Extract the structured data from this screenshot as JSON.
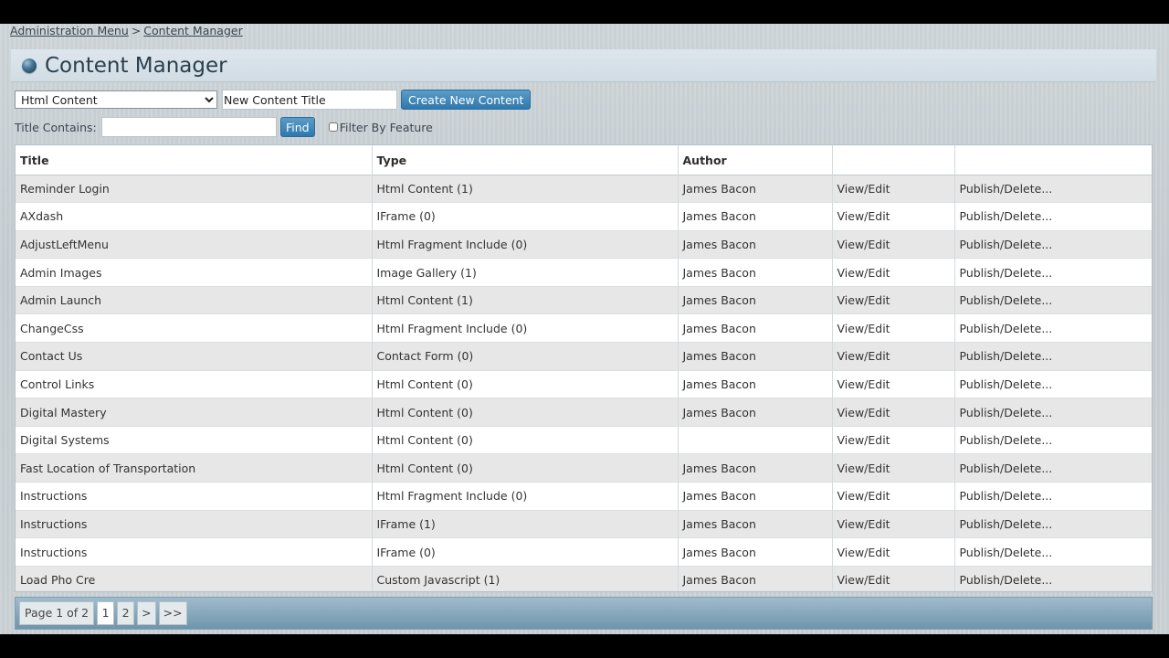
{
  "breadcrumb": {
    "items": [
      "Administration Menu",
      "Content Manager"
    ],
    "separator": ">"
  },
  "page": {
    "title": "Content Manager"
  },
  "create_bar": {
    "type_select_value": "Html Content",
    "new_title_value": "New Content Title",
    "create_button_label": "Create New Content"
  },
  "filter_bar": {
    "title_contains_label": "Title Contains:",
    "title_contains_value": "",
    "find_button_label": "Find",
    "filter_by_feature_label": "Filter By Feature",
    "filter_by_feature_checked": false
  },
  "table": {
    "columns": [
      "Title",
      "Type",
      "Author",
      "",
      ""
    ],
    "rows": [
      {
        "title": "Reminder Login",
        "type": "Html Content (1)",
        "author": "James Bacon",
        "view": "View/Edit",
        "publish": "Publish/Delete..."
      },
      {
        "title": "AXdash",
        "type": "IFrame (0)",
        "author": "James Bacon",
        "view": "View/Edit",
        "publish": "Publish/Delete..."
      },
      {
        "title": "AdjustLeftMenu",
        "type": "Html Fragment Include (0)",
        "author": "James Bacon",
        "view": "View/Edit",
        "publish": "Publish/Delete..."
      },
      {
        "title": "Admin Images",
        "type": "Image Gallery (1)",
        "author": "James Bacon",
        "view": "View/Edit",
        "publish": "Publish/Delete..."
      },
      {
        "title": "Admin Launch",
        "type": "Html Content (1)",
        "author": "James Bacon",
        "view": "View/Edit",
        "publish": "Publish/Delete..."
      },
      {
        "title": "ChangeCss",
        "type": "Html Fragment Include (0)",
        "author": "James Bacon",
        "view": "View/Edit",
        "publish": "Publish/Delete..."
      },
      {
        "title": "Contact Us",
        "type": "Contact Form (0)",
        "author": "James Bacon",
        "view": "View/Edit",
        "publish": "Publish/Delete..."
      },
      {
        "title": "Control Links",
        "type": "Html Content (0)",
        "author": "James Bacon",
        "view": "View/Edit",
        "publish": "Publish/Delete..."
      },
      {
        "title": "Digital Mastery",
        "type": "Html Content (0)",
        "author": "James Bacon",
        "view": "View/Edit",
        "publish": "Publish/Delete..."
      },
      {
        "title": "Digital Systems",
        "type": "Html Content (0)",
        "author": "",
        "view": "View/Edit",
        "publish": "Publish/Delete..."
      },
      {
        "title": "Fast Location of Transportation",
        "type": "Html Content (0)",
        "author": "James Bacon",
        "view": "View/Edit",
        "publish": "Publish/Delete..."
      },
      {
        "title": "Instructions",
        "type": "Html Fragment Include (0)",
        "author": "James Bacon",
        "view": "View/Edit",
        "publish": "Publish/Delete..."
      },
      {
        "title": "Instructions",
        "type": "IFrame (1)",
        "author": "James Bacon",
        "view": "View/Edit",
        "publish": "Publish/Delete..."
      },
      {
        "title": "Instructions",
        "type": "IFrame (0)",
        "author": "James Bacon",
        "view": "View/Edit",
        "publish": "Publish/Delete..."
      },
      {
        "title": "Load Pho Cre",
        "type": "Custom Javascript (1)",
        "author": "James Bacon",
        "view": "View/Edit",
        "publish": "Publish/Delete..."
      }
    ]
  },
  "pager": {
    "info": "Page 1 of 2",
    "pages": [
      "1",
      "2"
    ],
    "current_page": "1",
    "next_label": ">",
    "last_label": ">>"
  },
  "colors": {
    "button": "#2f78ad",
    "row_alt": "#e7e7e7",
    "title_text": "#2a3f4e",
    "pager_bar": "#6f95ab"
  },
  "icons": {
    "title_icon": "globe-orb-icon"
  }
}
